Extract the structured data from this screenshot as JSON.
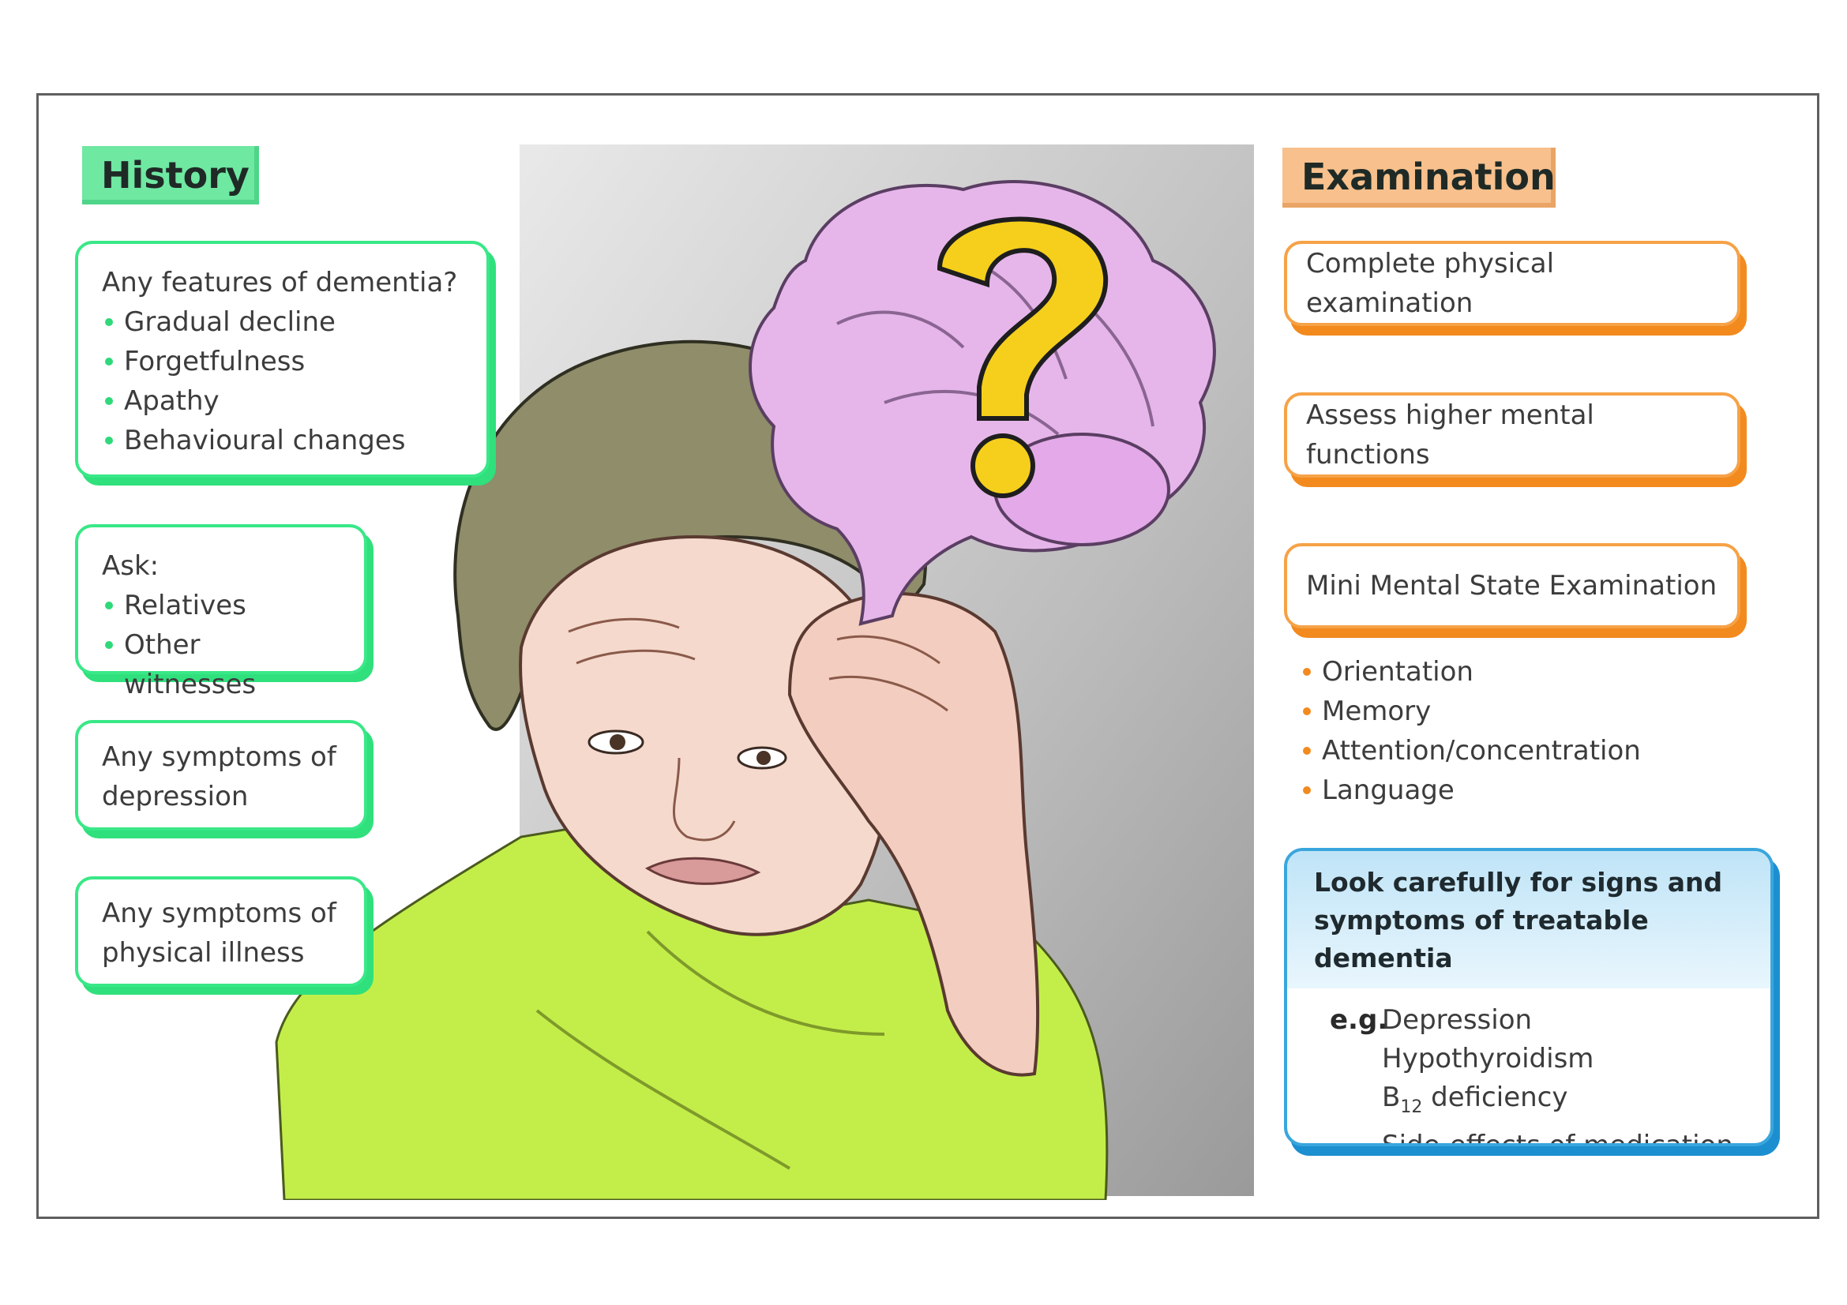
{
  "history": {
    "title": "History",
    "box1": {
      "heading": "Any features of dementia?",
      "items": [
        "Gradual decline",
        "Forgetfulness",
        "Apathy",
        "Behavioural changes"
      ]
    },
    "box2": {
      "heading": "Ask:",
      "items": [
        "Relatives",
        "Other witnesses"
      ]
    },
    "box3": {
      "line1": "Any symptoms of",
      "line2": "depression"
    },
    "box4": {
      "line1": "Any symptoms of",
      "line2": "physical illness"
    }
  },
  "examination": {
    "title": "Examination",
    "box1": "Complete physical examination",
    "box2": "Assess higher mental functions",
    "box3": "Mini Mental State Examination",
    "mmse_items": [
      "Orientation",
      "Memory",
      "Attention/concentration",
      "Language"
    ],
    "treatable": {
      "line1": "Look carefully for signs and",
      "line2": "symptoms of treatable dementia",
      "eg": "e.g.",
      "items": [
        "Depression",
        "Hypothyroidism",
        "deficiency",
        "Side-effects of medication"
      ],
      "b12_base": "B",
      "b12_sub": "12"
    }
  },
  "colors": {
    "history_green": "#39e887",
    "examination_orange": "#f28a1e",
    "treatable_blue": "#1c8fd0",
    "brain_pink": "#e6b6ea",
    "question_yellow": "#f5cf1c",
    "shirt_green": "#c3ee4a",
    "hair_gray": "#8f8d6a"
  },
  "icons": [
    "brain-icon",
    "question-mark-icon"
  ]
}
